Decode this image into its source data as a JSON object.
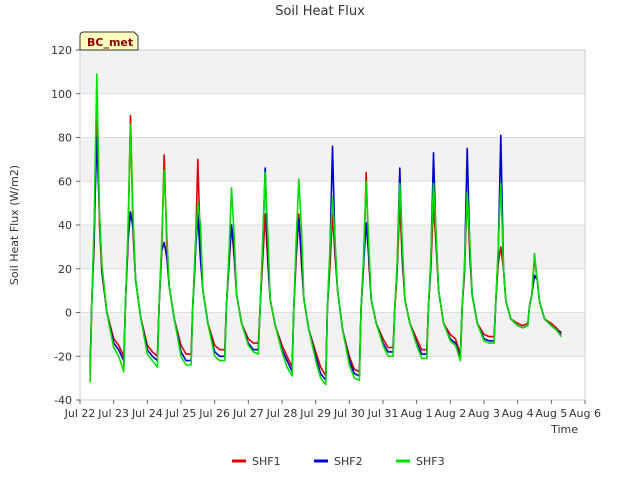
{
  "chart_data": {
    "type": "line",
    "title": "Soil Heat Flux",
    "xlabel": "Time",
    "ylabel": "Soil Heat Flux (W/m2)",
    "badge": "BC_met",
    "ylim": [
      -40,
      120
    ],
    "yticks": [
      -40,
      -20,
      0,
      20,
      40,
      60,
      80,
      100,
      120
    ],
    "xlim": [
      0,
      15
    ],
    "xticks": [
      {
        "v": 0,
        "label": "Jul 22"
      },
      {
        "v": 1,
        "label": "Jul 23"
      },
      {
        "v": 2,
        "label": "Jul 24"
      },
      {
        "v": 3,
        "label": "Jul 25"
      },
      {
        "v": 4,
        "label": "Jul 26"
      },
      {
        "v": 5,
        "label": "Jul 27"
      },
      {
        "v": 6,
        "label": "Jul 28"
      },
      {
        "v": 7,
        "label": "Jul 29"
      },
      {
        "v": 8,
        "label": "Jul 30"
      },
      {
        "v": 9,
        "label": "Jul 31"
      },
      {
        "v": 10,
        "label": "Aug 1"
      },
      {
        "v": 11,
        "label": "Aug 2"
      },
      {
        "v": 12,
        "label": "Aug 3"
      },
      {
        "v": 13,
        "label": "Aug 4"
      },
      {
        "v": 14,
        "label": "Aug 5"
      },
      {
        "v": 15,
        "label": "Aug 6"
      }
    ],
    "legend_position": "bottom",
    "grid": true,
    "x_day_offsets": [
      0.3,
      0.35,
      0.42,
      0.5,
      0.58,
      0.65,
      0.8,
      1.0,
      1.15,
      1.3
    ],
    "series": [
      {
        "name": "SHF1",
        "color": "#dd0000",
        "days": [
          [
            -25,
            5,
            30,
            101,
            40,
            18,
            0,
            -12,
            -15,
            -20
          ],
          [
            -22,
            5,
            28,
            90,
            35,
            15,
            -2,
            -15,
            -18,
            -20
          ],
          [
            -20,
            3,
            25,
            72,
            30,
            12,
            -3,
            -15,
            -19,
            -19
          ],
          [
            -19,
            3,
            22,
            70,
            28,
            10,
            -5,
            -15,
            -17,
            -17
          ],
          [
            -17,
            3,
            20,
            40,
            25,
            8,
            -5,
            -12,
            -14,
            -14
          ],
          [
            -14,
            2,
            22,
            45,
            22,
            6,
            -6,
            -15,
            -20,
            -25
          ],
          [
            -25,
            2,
            24,
            45,
            22,
            6,
            -8,
            -18,
            -25,
            -29
          ],
          [
            -29,
            2,
            20,
            45,
            25,
            10,
            -8,
            -20,
            -26,
            -27
          ],
          [
            -27,
            2,
            20,
            64,
            22,
            6,
            -5,
            -12,
            -16,
            -16
          ],
          [
            -16,
            2,
            18,
            50,
            22,
            6,
            -5,
            -12,
            -17,
            -17
          ],
          [
            -17,
            2,
            20,
            50,
            30,
            10,
            -5,
            -10,
            -12,
            -19
          ],
          [
            -19,
            2,
            18,
            55,
            25,
            8,
            -5,
            -10,
            -11,
            -11
          ],
          [
            -11,
            5,
            22,
            30,
            20,
            5,
            -3,
            -5,
            -6,
            -5
          ],
          [
            -5,
            3,
            8,
            25,
            15,
            5,
            -3,
            -5,
            -7,
            -10
          ]
        ]
      },
      {
        "name": "SHF2",
        "color": "#0000cc",
        "days": [
          [
            -28,
            5,
            35,
            80,
            45,
            20,
            0,
            -14,
            -17,
            -22
          ],
          [
            -24,
            5,
            32,
            46,
            38,
            15,
            -2,
            -17,
            -20,
            -22
          ],
          [
            -22,
            3,
            28,
            32,
            25,
            12,
            -3,
            -18,
            -22,
            -22
          ],
          [
            -22,
            3,
            25,
            45,
            24,
            10,
            -5,
            -18,
            -20,
            -20
          ],
          [
            -20,
            3,
            22,
            40,
            28,
            8,
            -5,
            -14,
            -17,
            -17
          ],
          [
            -17,
            2,
            28,
            66,
            25,
            6,
            -6,
            -17,
            -22,
            -27
          ],
          [
            -27,
            2,
            28,
            43,
            25,
            6,
            -8,
            -20,
            -28,
            -31
          ],
          [
            -31,
            2,
            25,
            76,
            28,
            10,
            -8,
            -22,
            -28,
            -29
          ],
          [
            -29,
            2,
            22,
            41,
            25,
            6,
            -5,
            -14,
            -18,
            -18
          ],
          [
            -18,
            2,
            20,
            66,
            25,
            6,
            -5,
            -14,
            -19,
            -19
          ],
          [
            -19,
            2,
            22,
            73,
            32,
            10,
            -5,
            -12,
            -14,
            -21
          ],
          [
            -21,
            2,
            20,
            75,
            28,
            8,
            -5,
            -12,
            -13,
            -13
          ],
          [
            -13,
            5,
            25,
            81,
            20,
            5,
            -3,
            -6,
            -7,
            -6
          ],
          [
            -6,
            3,
            8,
            17,
            15,
            5,
            -3,
            -6,
            -8,
            -9
          ]
        ]
      },
      {
        "name": "SHF3",
        "color": "#00e000",
        "days": [
          [
            -32,
            5,
            40,
            109,
            45,
            22,
            0,
            -16,
            -20,
            -27
          ],
          [
            -27,
            5,
            35,
            86,
            42,
            15,
            -2,
            -19,
            -22,
            -25
          ],
          [
            -25,
            3,
            30,
            65,
            35,
            12,
            -3,
            -20,
            -24,
            -24
          ],
          [
            -24,
            3,
            28,
            50,
            40,
            10,
            -5,
            -20,
            -22,
            -22
          ],
          [
            -22,
            3,
            25,
            57,
            35,
            8,
            -5,
            -15,
            -18,
            -19
          ],
          [
            -19,
            2,
            30,
            64,
            35,
            6,
            -6,
            -18,
            -25,
            -29
          ],
          [
            -29,
            2,
            32,
            61,
            38,
            6,
            -8,
            -22,
            -30,
            -33
          ],
          [
            -33,
            2,
            28,
            53,
            32,
            10,
            -8,
            -24,
            -30,
            -31
          ],
          [
            -31,
            2,
            25,
            60,
            30,
            6,
            -5,
            -15,
            -20,
            -20
          ],
          [
            -20,
            2,
            22,
            59,
            30,
            6,
            -5,
            -15,
            -21,
            -21
          ],
          [
            -21,
            2,
            25,
            59,
            35,
            10,
            -5,
            -13,
            -15,
            -22
          ],
          [
            -22,
            2,
            22,
            55,
            32,
            8,
            -5,
            -13,
            -14,
            -14
          ],
          [
            -14,
            5,
            28,
            59,
            20,
            5,
            -3,
            -6,
            -7,
            -6
          ],
          [
            -6,
            3,
            8,
            27,
            15,
            5,
            -3,
            -6,
            -8,
            -11
          ]
        ]
      }
    ]
  }
}
